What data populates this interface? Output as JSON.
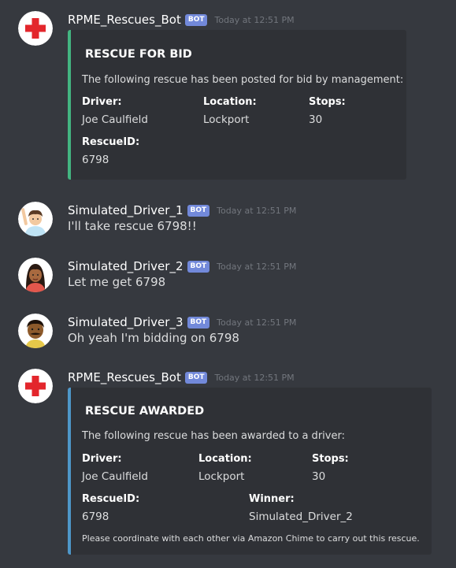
{
  "messages": [
    {
      "author": "RPME_Rescues_Bot",
      "badge": "BOT",
      "timestamp": "Today at 12:51 PM",
      "avatar": "red-cross-icon",
      "embed": {
        "title": "RESCUE FOR BID",
        "description": "The following rescue has been posted for bid by management:",
        "accent": "#43b581",
        "fields": [
          {
            "name": "Driver:",
            "value": "Joe Caulfield"
          },
          {
            "name": "Location:",
            "value": "Lockport"
          },
          {
            "name": "Stops:",
            "value": "30"
          },
          {
            "name": "RescueID:",
            "value": "6798"
          }
        ]
      }
    },
    {
      "author": "Simulated_Driver_1",
      "badge": "BOT",
      "timestamp": "Today at 12:51 PM",
      "avatar": "waving-man-avatar-icon",
      "text": "I'll take rescue 6798!!"
    },
    {
      "author": "Simulated_Driver_2",
      "badge": "BOT",
      "timestamp": "Today at 12:51 PM",
      "avatar": "woman-avatar-icon",
      "text": "Let me get 6798"
    },
    {
      "author": "Simulated_Driver_3",
      "badge": "BOT",
      "timestamp": "Today at 12:51 PM",
      "avatar": "mustache-man-avatar-icon",
      "text": "Oh yeah I'm bidding on 6798"
    },
    {
      "author": "RPME_Rescues_Bot",
      "badge": "BOT",
      "timestamp": "Today at 12:51 PM",
      "avatar": "red-cross-icon",
      "embed": {
        "title": "RESCUE AWARDED",
        "description": "The following rescue has been awarded to a driver:",
        "accent": "#4e97c9",
        "fields": [
          {
            "name": "Driver:",
            "value": "Joe Caulfield"
          },
          {
            "name": "Location:",
            "value": "Lockport"
          },
          {
            "name": "Stops:",
            "value": "30"
          },
          {
            "name": "RescueID:",
            "value": "6798"
          },
          {
            "name": "Winner:",
            "value": "Simulated_Driver_2"
          }
        ],
        "footer": "Please coordinate with each other via Amazon Chime to carry out this rescue."
      }
    }
  ],
  "colors": {
    "background": "#36393f",
    "embed_bg": "#2f3136",
    "bot_badge": "#7289da",
    "timestamp": "#72767d"
  }
}
